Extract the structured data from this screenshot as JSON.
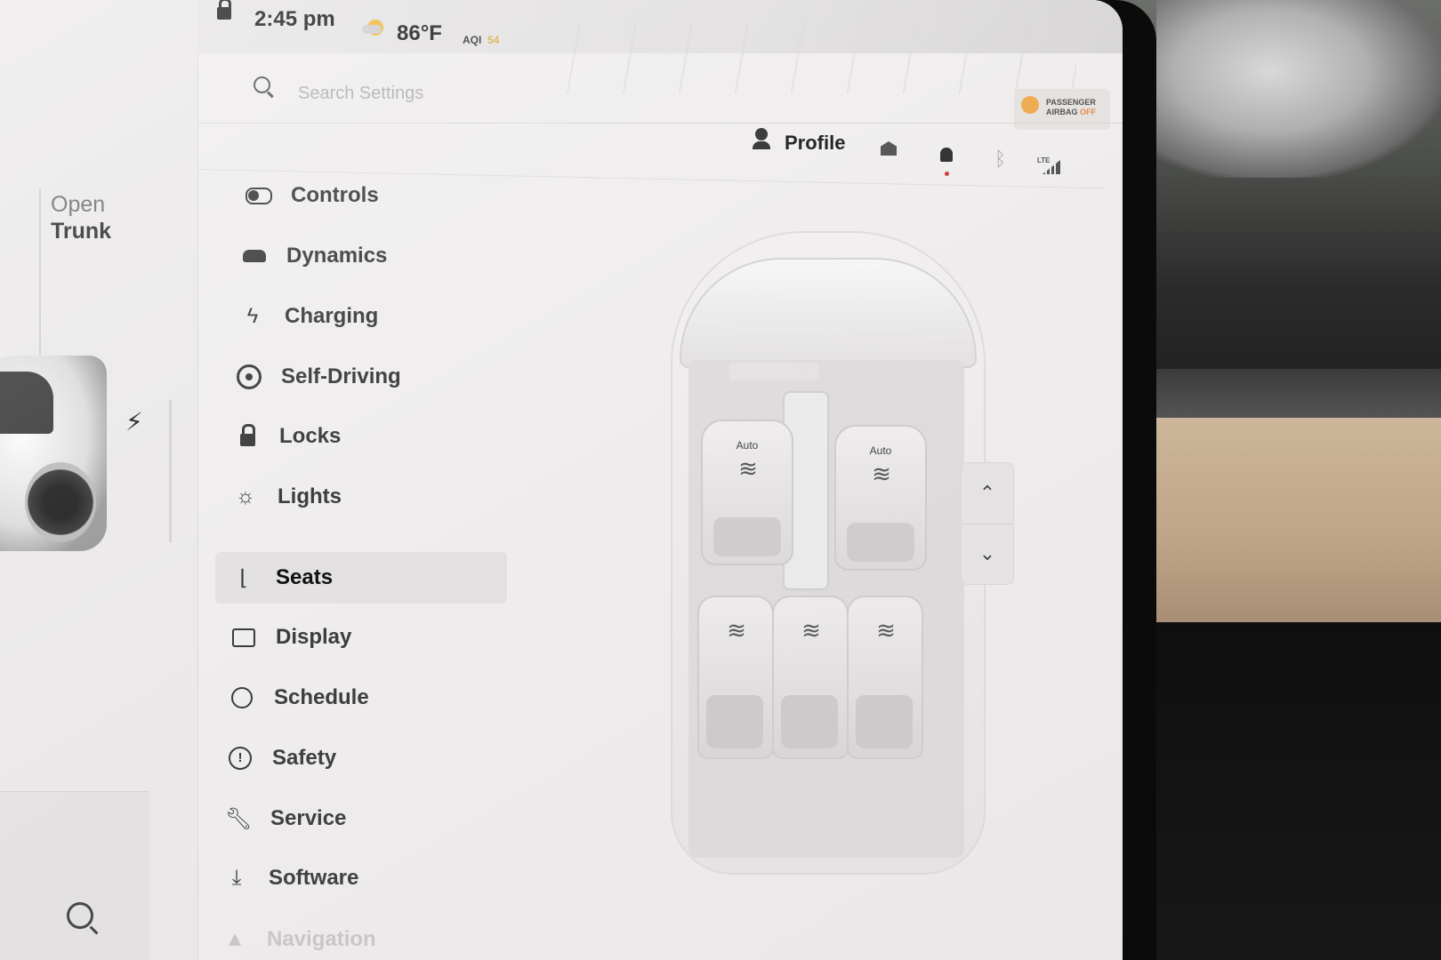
{
  "status_bar": {
    "time": "2:45 pm",
    "temperature": "86°F",
    "aqi_label": "AQI",
    "aqi_value": "54",
    "icons": [
      "lock-icon",
      "weather-icon"
    ]
  },
  "left_panel": {
    "open_trunk_line1": "Open",
    "open_trunk_line2": "Trunk",
    "icons": [
      "charge-bolt-icon",
      "search-icon"
    ]
  },
  "search": {
    "placeholder": "Search Settings"
  },
  "header": {
    "profile_label": "Profile",
    "icons": [
      "profile-icon",
      "garage-icon",
      "bell-icon",
      "bluetooth-icon",
      "lte-signal-icon"
    ],
    "lte_label": "LTE",
    "airbag_line1": "PASSENGER",
    "airbag_line2": "AIRBAG",
    "airbag_status": "OFF"
  },
  "menu": {
    "items": [
      {
        "label": "Controls",
        "icon": "toggle-icon"
      },
      {
        "label": "Dynamics",
        "icon": "car-icon"
      },
      {
        "label": "Charging",
        "icon": "lightning-icon"
      },
      {
        "label": "Self-Driving",
        "icon": "steering-wheel-icon"
      },
      {
        "label": "Locks",
        "icon": "lock-icon"
      },
      {
        "label": "Lights",
        "icon": "light-icon"
      },
      {
        "label": "Seats",
        "icon": "seat-icon",
        "selected": true
      },
      {
        "label": "Display",
        "icon": "display-icon"
      },
      {
        "label": "Schedule",
        "icon": "clock-icon"
      },
      {
        "label": "Safety",
        "icon": "alert-icon"
      },
      {
        "label": "Service",
        "icon": "wrench-icon"
      },
      {
        "label": "Software",
        "icon": "download-icon"
      },
      {
        "label": "Navigation",
        "icon": "navigation-icon"
      }
    ]
  },
  "seats": {
    "driver_label": "Auto",
    "passenger_label": "Auto",
    "heater_glyph": "≋",
    "rear_seats": [
      "rear-left",
      "rear-center",
      "rear-right"
    ],
    "scroll_up": "⌃",
    "scroll_down": "⌄"
  },
  "colors": {
    "screen_bg": "#efeded",
    "selected_item_bg": "#e3e1e1",
    "aqi_value": "#d4b24b",
    "notification_dot": "#d23c3c",
    "airbag_off": "#e8884a"
  }
}
